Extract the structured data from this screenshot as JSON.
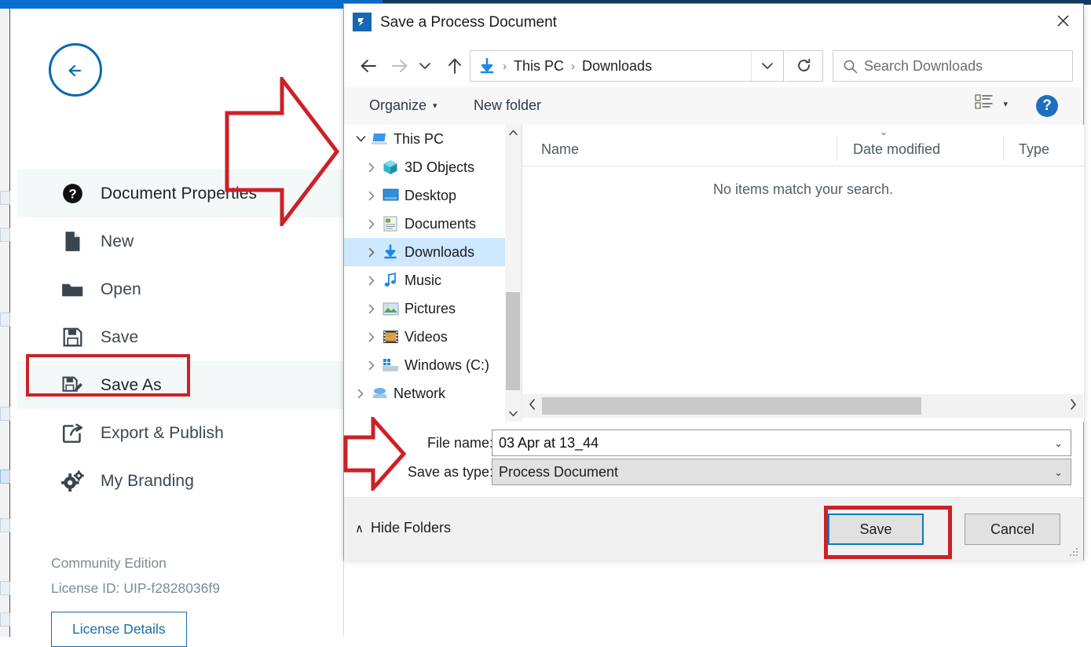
{
  "app": {
    "back_button": "back-arrow-icon",
    "menu_items": [
      {
        "label": "Document Properties",
        "icon": "question-mark-icon",
        "active": true
      },
      {
        "label": "New",
        "icon": "document-icon",
        "active": false
      },
      {
        "label": "Open",
        "icon": "folder-open-icon",
        "active": false
      },
      {
        "label": "Save",
        "icon": "floppy-disk-icon",
        "active": false
      },
      {
        "label": "Save As",
        "icon": "floppy-disk-pencil-icon",
        "active": true
      },
      {
        "label": "Export & Publish",
        "icon": "share-arrow-icon",
        "active": false
      },
      {
        "label": "My Branding",
        "icon": "gears-icon",
        "active": false
      }
    ],
    "license": {
      "edition": "Community Edition",
      "license_id": "License ID: UIP-f2828036f9",
      "details_button": "License Details"
    },
    "accent_color": "#ee5c3c",
    "brand_blue": "#0a6ed1"
  },
  "dialog": {
    "title": "Save a Process Document",
    "app_icon": "app-icon",
    "close_icon": "close-icon",
    "nav": {
      "back_icon": "arrow-left-icon",
      "forward_icon": "arrow-right-icon",
      "recent_icon": "chevron-down-icon",
      "up_icon": "arrow-up-icon",
      "breadcrumb": {
        "location_icon": "downloads-arrow-icon",
        "parts": [
          "This PC",
          "Downloads"
        ],
        "separator": "›",
        "dropdown_icon": "chevron-down-icon"
      },
      "refresh_icon": "refresh-icon",
      "search_placeholder": "Search Downloads",
      "search_value": "",
      "search_icon": "search-icon"
    },
    "toolbar": {
      "organize": "Organize",
      "organize_caret": "▾",
      "new_folder": "New folder",
      "view_icon": "view-list-icon",
      "view_caret": "▾",
      "help": "?"
    },
    "tree": [
      {
        "label": "This PC",
        "icon": "computer-icon",
        "expanded": true,
        "indent": 0,
        "selected": false
      },
      {
        "label": "3D Objects",
        "icon": "3d-objects-icon",
        "expanded": false,
        "indent": 1,
        "selected": false
      },
      {
        "label": "Desktop",
        "icon": "desktop-icon",
        "expanded": false,
        "indent": 1,
        "selected": false
      },
      {
        "label": "Documents",
        "icon": "documents-icon",
        "expanded": false,
        "indent": 1,
        "selected": false
      },
      {
        "label": "Downloads",
        "icon": "downloads-icon",
        "expanded": false,
        "indent": 1,
        "selected": true
      },
      {
        "label": "Music",
        "icon": "music-icon",
        "expanded": false,
        "indent": 1,
        "selected": false
      },
      {
        "label": "Pictures",
        "icon": "pictures-icon",
        "expanded": false,
        "indent": 1,
        "selected": false
      },
      {
        "label": "Videos",
        "icon": "videos-icon",
        "expanded": false,
        "indent": 1,
        "selected": false
      },
      {
        "label": "Windows (C:)",
        "icon": "drive-icon",
        "expanded": false,
        "indent": 1,
        "selected": false
      },
      {
        "label": "Network",
        "icon": "network-icon",
        "expanded": false,
        "indent": 0,
        "selected": false
      }
    ],
    "file_list": {
      "columns": [
        "Name",
        "Date modified",
        "Type"
      ],
      "sort_indicator": "⌄",
      "rows": [],
      "empty_message": "No items match your search."
    },
    "fields": {
      "filename_label": "File name:",
      "filename_value": "03 Apr at 13_44",
      "filetype_label": "Save as type:",
      "filetype_value": "Process Document",
      "caret": "⌄"
    },
    "actions": {
      "hide_folders_caret": "∧",
      "hide_folders": "Hide Folders",
      "save": "Save",
      "cancel": "Cancel"
    }
  },
  "annotations": {
    "color": "#cc2127",
    "boxes": [
      "save-as-menu-item",
      "save-button"
    ],
    "arrows": [
      "points-to-document-properties",
      "points-to-file-name-field"
    ]
  }
}
